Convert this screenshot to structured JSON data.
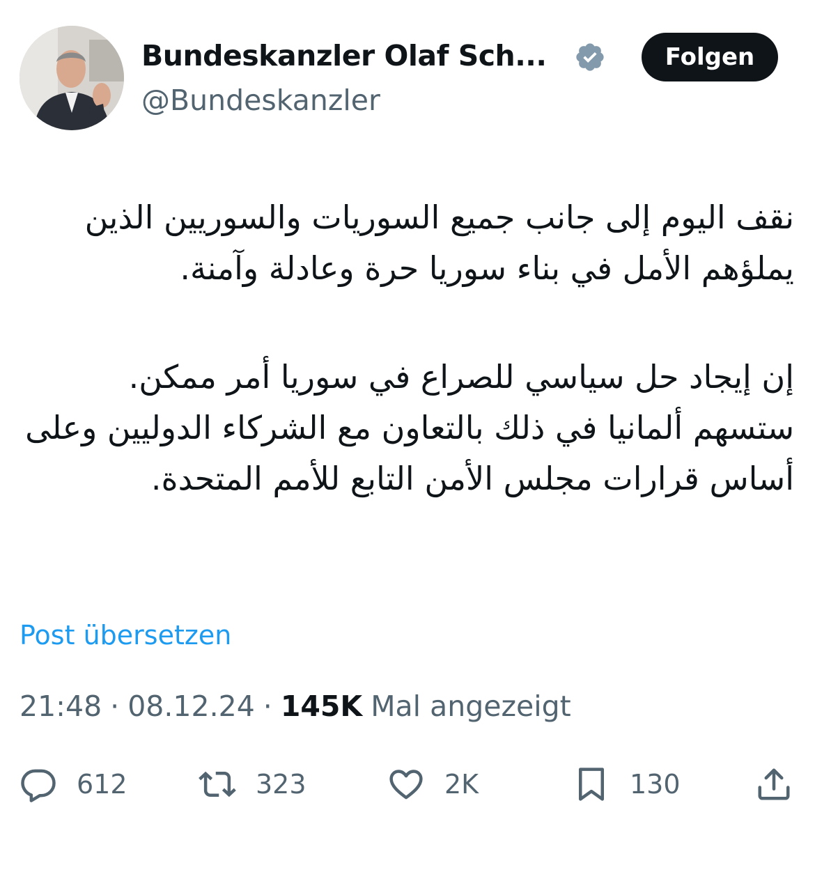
{
  "author": {
    "name": "Bundeskanzler Olaf Sch...",
    "handle": "@Bundeskanzler",
    "verified_color": "#829aab"
  },
  "follow_button": {
    "label": "Folgen"
  },
  "tweet": {
    "paragraph_1": "نقف اليوم إلى جانب جميع السوريات والسوريين الذين يملؤهم الأمل في بناء سوريا حرة وعادلة وآمنة.",
    "paragraph_2": "إن إيجاد حل سياسي للصراع في سوريا أمر ممكن. ستسهم ألمانيا في ذلك بالتعاون مع الشركاء الدوليين وعلى أساس قرارات مجلس الأمن التابع للأمم المتحدة."
  },
  "translate_link": "Post übersetzen",
  "meta": {
    "time": "21:48",
    "date": "08.12.24",
    "separator": "·",
    "views_count": "145K",
    "views_label": "Mal angezeigt"
  },
  "actions": {
    "replies": "612",
    "reposts": "323",
    "likes": "2K",
    "bookmarks": "130"
  },
  "colors": {
    "link": "#1d9bf0",
    "secondary_text": "#536471",
    "primary_text": "#0f1419"
  }
}
